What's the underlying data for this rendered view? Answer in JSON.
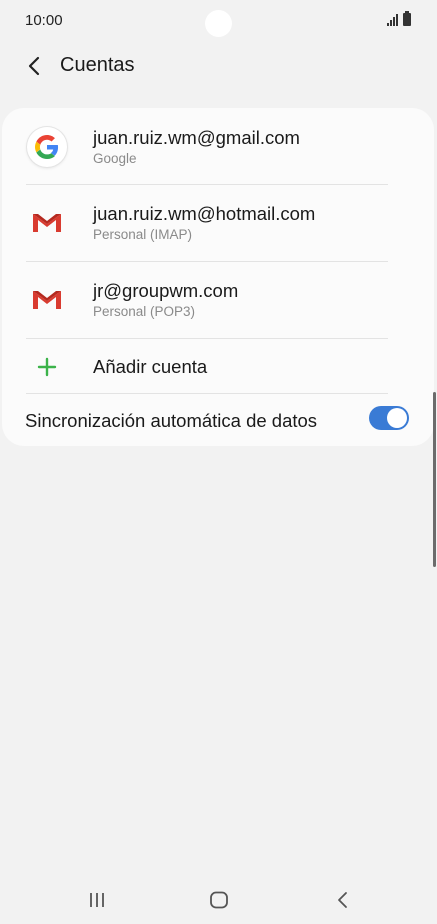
{
  "status_bar": {
    "time": "10:00"
  },
  "header": {
    "title": "Cuentas"
  },
  "accounts": [
    {
      "email": "juan.ruiz.wm@gmail.com",
      "type": "Google",
      "icon": "google-icon"
    },
    {
      "email": "juan.ruiz.wm@hotmail.com",
      "type": "Personal (IMAP)",
      "icon": "gmail-icon"
    },
    {
      "email": "jr@groupwm.com",
      "type": "Personal (POP3)",
      "icon": "gmail-icon"
    }
  ],
  "add_account": {
    "label": "Añadir cuenta",
    "icon": "plus-icon"
  },
  "sync": {
    "label": "Sincronización automática de datos",
    "enabled": true
  },
  "colors": {
    "accent": "#3a7bd5",
    "plus": "#3cb34a",
    "gmail_red": "#d93b30"
  }
}
